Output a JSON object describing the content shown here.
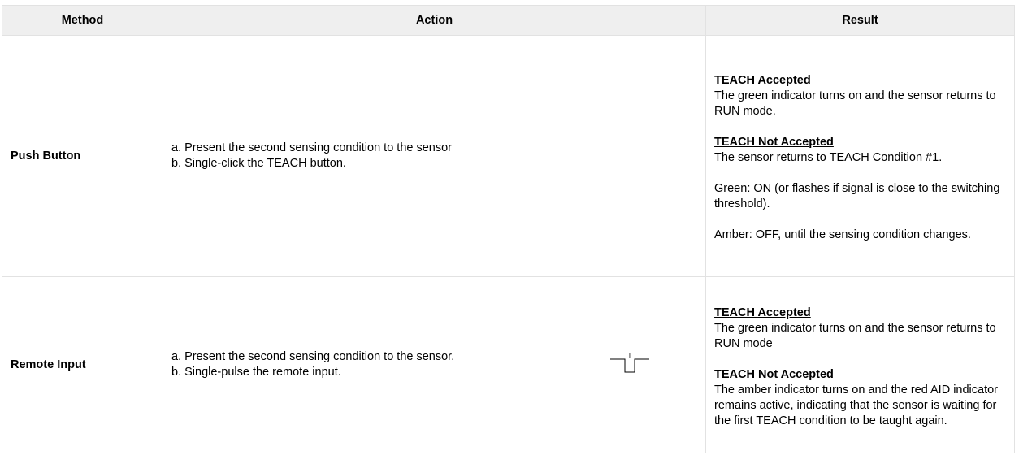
{
  "headers": {
    "method": "Method",
    "action": "Action",
    "result": "Result"
  },
  "rows": [
    {
      "method": "Push Button",
      "action": [
        "a. Present the second sensing condition to the sensor",
        "b. Single-click the TEACH button."
      ],
      "result": {
        "accepted_title": "TEACH Accepted",
        "accepted_text": "The green indicator turns on and the sensor returns to RUN mode.",
        "not_accepted_title": "TEACH Not Accepted",
        "not_accepted_text": "The sensor returns to TEACH Condition #1.",
        "green_text": "Green: ON (or flashes if signal is close to the switching threshold).",
        "amber_text": "Amber: OFF, until the sensing condition changes."
      }
    },
    {
      "method": "Remote Input",
      "action": [
        "a. Present the second sensing condition to the sensor.",
        "b. Single-pulse the remote input."
      ],
      "pulse_label": "T",
      "result": {
        "accepted_title": "TEACH Accepted",
        "accepted_text": "The green indicator turns on and the sensor returns to RUN mode",
        "not_accepted_title": "TEACH Not Accepted",
        "not_accepted_text": "The amber indicator turns on and the red AID indicator remains active, indicating that the sensor is waiting for the first TEACH condition to be taught again."
      }
    }
  ]
}
